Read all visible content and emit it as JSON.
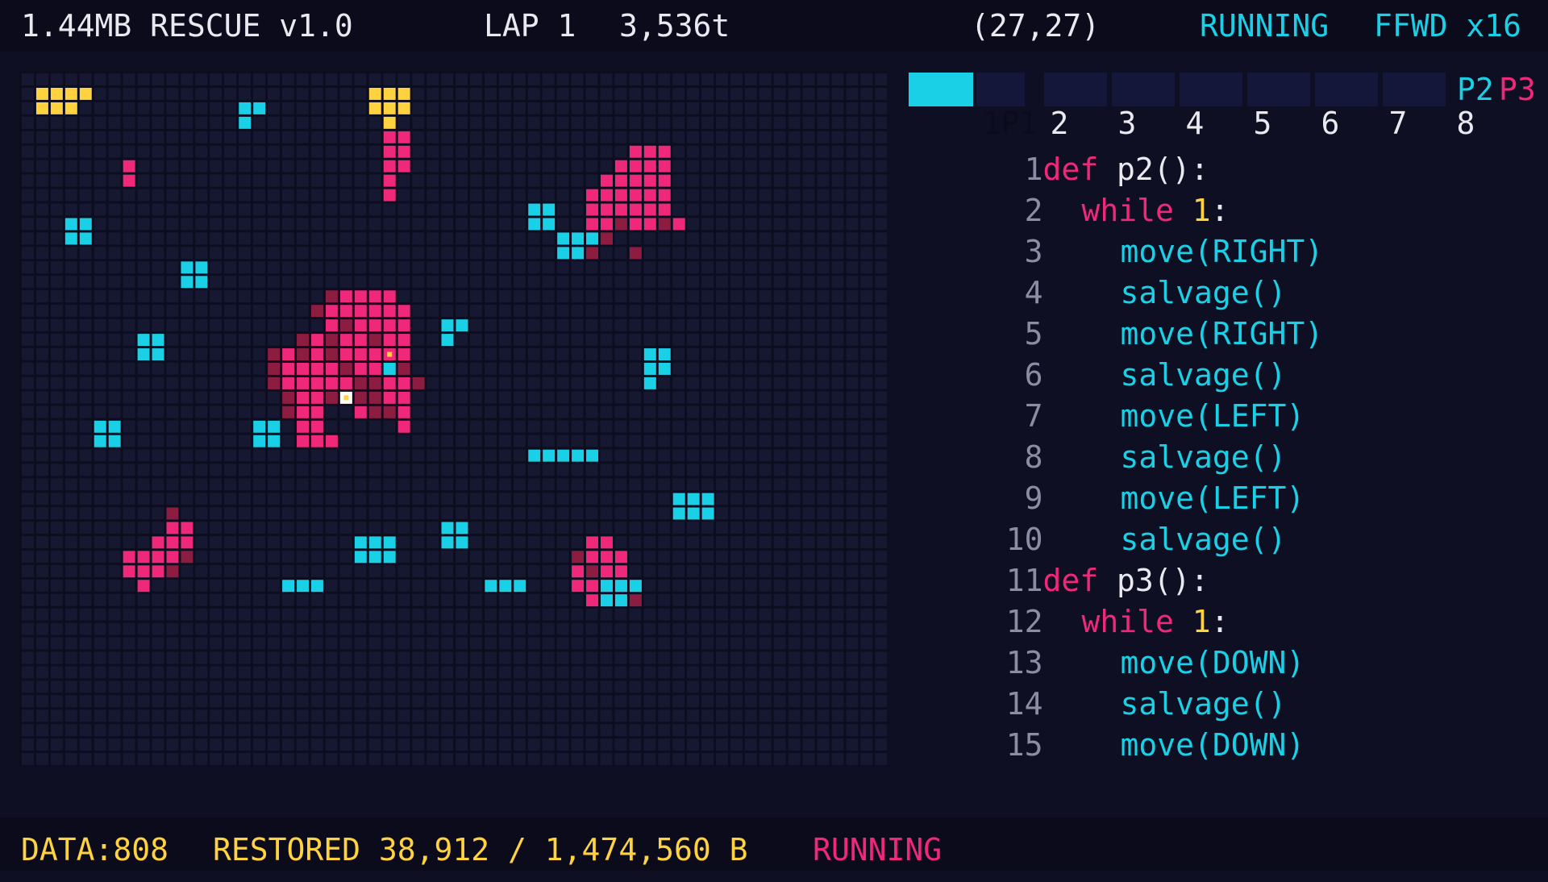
{
  "header": {
    "title": "1.44MB RESCUE v1.0",
    "lap": "LAP 1",
    "ticks": "3,536t",
    "coords": "(27,27)",
    "status": "RUNNING",
    "speed": "FFWD x16"
  },
  "tabs": {
    "items": [
      "1",
      "2",
      "3",
      "4",
      "5",
      "6",
      "7",
      "8"
    ],
    "active_label": "1P1",
    "p2": "P2",
    "p3": "P3"
  },
  "code": {
    "lines": [
      {
        "n": "1",
        "kw": "def",
        "rest": " p2():"
      },
      {
        "n": "2",
        "kw": "while",
        "num": " 1",
        "rest": ":"
      },
      {
        "n": "3",
        "call": "move(RIGHT)"
      },
      {
        "n": "4",
        "call": "salvage()"
      },
      {
        "n": "5",
        "call": "move(RIGHT)"
      },
      {
        "n": "6",
        "call": "salvage()"
      },
      {
        "n": "7",
        "call": "move(LEFT)"
      },
      {
        "n": "8",
        "call": "salvage()"
      },
      {
        "n": "9",
        "call": "move(LEFT)"
      },
      {
        "n": "10",
        "call": "salvage()"
      },
      {
        "n": "11",
        "kw": "def",
        "rest": " p3():"
      },
      {
        "n": "12",
        "kw": "while",
        "num": " 1",
        "rest": ":"
      },
      {
        "n": "13",
        "call": "move(DOWN)"
      },
      {
        "n": "14",
        "call": "salvage()"
      },
      {
        "n": "15",
        "call": "move(DOWN)"
      }
    ]
  },
  "footer": {
    "data": "DATA:808",
    "restored": "RESTORED 38,912 / 1,474,560 B",
    "status": "RUNNING"
  },
  "colors": {
    "cyan": "#19d0e6",
    "pink": "#f0287a",
    "dark_red": "#8c1c40",
    "yellow": "#ffd23f",
    "grid": "#161731",
    "background": "#0e0f22"
  },
  "board": {
    "cells": {
      "cyan": [
        [
          15,
          2
        ],
        [
          16,
          2
        ],
        [
          15,
          3
        ],
        [
          3,
          10
        ],
        [
          4,
          10
        ],
        [
          3,
          11
        ],
        [
          4,
          11
        ],
        [
          11,
          13
        ],
        [
          12,
          13
        ],
        [
          11,
          14
        ],
        [
          12,
          14
        ],
        [
          8,
          18
        ],
        [
          9,
          18
        ],
        [
          8,
          19
        ],
        [
          9,
          19
        ],
        [
          5,
          24
        ],
        [
          6,
          24
        ],
        [
          5,
          25
        ],
        [
          6,
          25
        ],
        [
          16,
          24
        ],
        [
          17,
          24
        ],
        [
          16,
          25
        ],
        [
          17,
          25
        ],
        [
          35,
          9
        ],
        [
          36,
          9
        ],
        [
          35,
          10
        ],
        [
          36,
          10
        ],
        [
          37,
          11
        ],
        [
          38,
          11
        ],
        [
          39,
          11
        ],
        [
          37,
          12
        ],
        [
          38,
          12
        ],
        [
          29,
          17
        ],
        [
          30,
          17
        ],
        [
          29,
          18
        ],
        [
          43,
          19
        ],
        [
          44,
          19
        ],
        [
          43,
          20
        ],
        [
          44,
          20
        ],
        [
          43,
          21
        ],
        [
          35,
          26
        ],
        [
          36,
          26
        ],
        [
          37,
          26
        ],
        [
          38,
          26
        ],
        [
          39,
          26
        ],
        [
          45,
          29
        ],
        [
          46,
          29
        ],
        [
          47,
          29
        ],
        [
          45,
          30
        ],
        [
          46,
          30
        ],
        [
          47,
          30
        ],
        [
          29,
          31
        ],
        [
          30,
          31
        ],
        [
          29,
          32
        ],
        [
          30,
          32
        ],
        [
          23,
          32
        ],
        [
          24,
          32
        ],
        [
          25,
          32
        ],
        [
          23,
          33
        ],
        [
          24,
          33
        ],
        [
          25,
          33
        ],
        [
          18,
          35
        ],
        [
          19,
          35
        ],
        [
          20,
          35
        ],
        [
          32,
          35
        ],
        [
          33,
          35
        ],
        [
          34,
          35
        ],
        [
          40,
          35
        ],
        [
          41,
          35
        ],
        [
          42,
          35
        ],
        [
          40,
          36
        ],
        [
          41,
          36
        ],
        [
          25,
          20
        ]
      ],
      "pink": [
        [
          7,
          6
        ],
        [
          7,
          7
        ],
        [
          25,
          4
        ],
        [
          26,
          4
        ],
        [
          25,
          5
        ],
        [
          26,
          5
        ],
        [
          25,
          6
        ],
        [
          26,
          6
        ],
        [
          25,
          7
        ],
        [
          25,
          8
        ],
        [
          42,
          5
        ],
        [
          43,
          5
        ],
        [
          44,
          5
        ],
        [
          41,
          6
        ],
        [
          42,
          6
        ],
        [
          43,
          6
        ],
        [
          44,
          6
        ],
        [
          40,
          7
        ],
        [
          41,
          7
        ],
        [
          42,
          7
        ],
        [
          43,
          7
        ],
        [
          44,
          7
        ],
        [
          39,
          8
        ],
        [
          40,
          8
        ],
        [
          41,
          8
        ],
        [
          42,
          8
        ],
        [
          43,
          8
        ],
        [
          44,
          8
        ],
        [
          39,
          9
        ],
        [
          40,
          9
        ],
        [
          41,
          9
        ],
        [
          42,
          9
        ],
        [
          43,
          9
        ],
        [
          44,
          9
        ],
        [
          39,
          10
        ],
        [
          40,
          10
        ],
        [
          42,
          10
        ],
        [
          43,
          10
        ],
        [
          45,
          10
        ],
        [
          38,
          11
        ],
        [
          39,
          11
        ],
        [
          40,
          11
        ],
        [
          22,
          15
        ],
        [
          23,
          15
        ],
        [
          24,
          15
        ],
        [
          25,
          15
        ],
        [
          21,
          16
        ],
        [
          22,
          16
        ],
        [
          23,
          16
        ],
        [
          24,
          16
        ],
        [
          25,
          16
        ],
        [
          26,
          16
        ],
        [
          21,
          17
        ],
        [
          23,
          17
        ],
        [
          24,
          17
        ],
        [
          25,
          17
        ],
        [
          26,
          17
        ],
        [
          20,
          18
        ],
        [
          22,
          18
        ],
        [
          23,
          18
        ],
        [
          25,
          18
        ],
        [
          26,
          18
        ],
        [
          18,
          19
        ],
        [
          20,
          19
        ],
        [
          22,
          19
        ],
        [
          23,
          19
        ],
        [
          24,
          19
        ],
        [
          26,
          19
        ],
        [
          18,
          20
        ],
        [
          19,
          20
        ],
        [
          20,
          20
        ],
        [
          21,
          20
        ],
        [
          23,
          20
        ],
        [
          24,
          20
        ],
        [
          25,
          20
        ],
        [
          18,
          21
        ],
        [
          19,
          21
        ],
        [
          20,
          21
        ],
        [
          21,
          21
        ],
        [
          22,
          21
        ],
        [
          25,
          21
        ],
        [
          26,
          21
        ],
        [
          19,
          22
        ],
        [
          20,
          22
        ],
        [
          25,
          22
        ],
        [
          26,
          22
        ],
        [
          19,
          23
        ],
        [
          20,
          23
        ],
        [
          23,
          23
        ],
        [
          26,
          23
        ],
        [
          19,
          24
        ],
        [
          20,
          24
        ],
        [
          26,
          24
        ],
        [
          19,
          25
        ],
        [
          20,
          25
        ],
        [
          21,
          25
        ],
        [
          10,
          31
        ],
        [
          11,
          31
        ],
        [
          9,
          32
        ],
        [
          10,
          32
        ],
        [
          11,
          32
        ],
        [
          7,
          33
        ],
        [
          8,
          33
        ],
        [
          9,
          33
        ],
        [
          10,
          33
        ],
        [
          7,
          34
        ],
        [
          8,
          34
        ],
        [
          9,
          34
        ],
        [
          8,
          35
        ],
        [
          39,
          32
        ],
        [
          40,
          32
        ],
        [
          39,
          33
        ],
        [
          40,
          33
        ],
        [
          41,
          33
        ],
        [
          38,
          34
        ],
        [
          40,
          34
        ],
        [
          41,
          34
        ],
        [
          38,
          35
        ],
        [
          39,
          35
        ],
        [
          40,
          35
        ],
        [
          41,
          35
        ],
        [
          39,
          36
        ]
      ],
      "dark": [
        [
          41,
          10
        ],
        [
          44,
          10
        ],
        [
          40,
          11
        ],
        [
          39,
          12
        ],
        [
          42,
          12
        ],
        [
          21,
          15
        ],
        [
          20,
          16
        ],
        [
          22,
          17
        ],
        [
          19,
          18
        ],
        [
          21,
          18
        ],
        [
          24,
          18
        ],
        [
          17,
          19
        ],
        [
          19,
          19
        ],
        [
          21,
          19
        ],
        [
          25,
          19
        ],
        [
          17,
          20
        ],
        [
          22,
          20
        ],
        [
          26,
          20
        ],
        [
          17,
          21
        ],
        [
          23,
          21
        ],
        [
          24,
          21
        ],
        [
          27,
          21
        ],
        [
          18,
          22
        ],
        [
          21,
          22
        ],
        [
          22,
          22
        ],
        [
          23,
          22
        ],
        [
          24,
          22
        ],
        [
          18,
          23
        ],
        [
          24,
          23
        ],
        [
          25,
          23
        ],
        [
          10,
          30
        ],
        [
          11,
          33
        ],
        [
          10,
          34
        ],
        [
          38,
          33
        ],
        [
          41,
          36
        ],
        [
          42,
          36
        ],
        [
          39,
          34
        ],
        [
          42,
          35
        ]
      ],
      "yellow": [
        [
          1,
          1
        ],
        [
          2,
          1
        ],
        [
          3,
          1
        ],
        [
          4,
          1
        ],
        [
          1,
          2
        ],
        [
          2,
          2
        ],
        [
          3,
          2
        ],
        [
          24,
          1
        ],
        [
          25,
          1
        ],
        [
          26,
          1
        ],
        [
          24,
          2
        ],
        [
          25,
          2
        ],
        [
          26,
          2
        ],
        [
          25,
          3
        ]
      ]
    },
    "units": [
      {
        "kind": "cursor",
        "col": 25,
        "row": 19
      },
      {
        "kind": "player",
        "col": 22,
        "row": 22
      }
    ]
  }
}
